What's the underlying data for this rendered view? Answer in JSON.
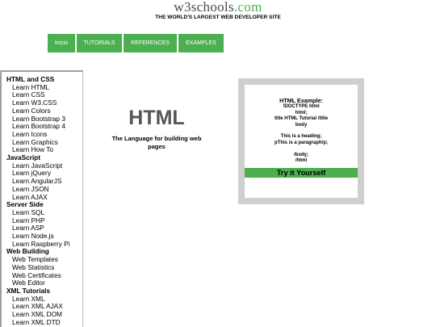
{
  "header": {
    "logo_main": "w3schools",
    "logo_tld": ".com",
    "tagline": "THE WORLD'S LARGEST WEB DEVELOPER SITE"
  },
  "topnav": {
    "items": [
      {
        "label": "Inicio"
      },
      {
        "label": "TUTORIALS"
      },
      {
        "label": "REFERENCES"
      },
      {
        "label": "EXAMPLES"
      }
    ]
  },
  "sidebar": {
    "groups": [
      {
        "title": "HTML and CSS",
        "links": [
          "Learn HTML",
          "Learn CSS",
          "Learn W3.CSS",
          "Learn Colors",
          "Learn Bootstrap 3",
          "Learn Bootstrap 4",
          "Learn Icons",
          "Learn Graphics",
          "Learn How To"
        ]
      },
      {
        "title": "JavaScript",
        "links": [
          "Learn JavaScript",
          "Learn jQuery",
          "Learn AngularJS",
          "Learn JSON",
          "Learn AJAX"
        ]
      },
      {
        "title": "Server Side",
        "links": [
          "Learn SQL",
          "Learn PHP",
          "Learn ASP",
          "Learn Node.js",
          "Learn Raspberry Pi"
        ]
      },
      {
        "title": "Web Building",
        "links": [
          "Web Templates",
          "Web Statistics",
          "Web Certificates",
          "Web Editor"
        ]
      },
      {
        "title": "XML Tutorials",
        "links": [
          "Learn XML",
          "Learn XML AJAX",
          "Learn XML DOM",
          "Learn XML DTD"
        ]
      }
    ]
  },
  "hero": {
    "title": "HTML",
    "subtitle": "The Language for building web pages"
  },
  "example": {
    "title": "HTML Example:",
    "lines_a": [
      "!DOCTYPE html",
      "html;",
      "title HTML Tutorial /title",
      "body"
    ],
    "lines_b": [
      "This is a heading;",
      "pThis is a paragraph/p;"
    ],
    "lines_c": [
      "/body;",
      "/html"
    ],
    "button_label": "Try it Yourself"
  },
  "colors": {
    "accent": "#4CAF50",
    "example_frame": "#cfcfcf"
  }
}
